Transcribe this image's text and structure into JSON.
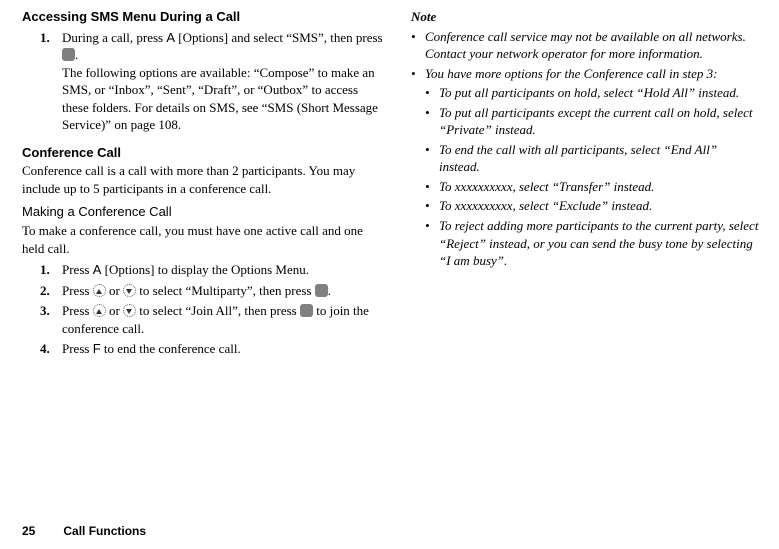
{
  "left": {
    "h1": "Accessing SMS Menu During a Call",
    "step1_num": "1.",
    "step1_a": "During a call, press ",
    "step1_key": "A",
    "step1_b": " [Options] and select “SMS”, then press ",
    "step1_c": ".",
    "step1_p2": "The following options are available: “Compose” to make an SMS, or “Inbox”, “Sent”, “Draft”, or “Outbox” to access these folders. For details on SMS, see “SMS (Short Message Service)” on page 108.",
    "h2": "Conference Call",
    "conf_intro": "Conference call is a call with more than 2 participants. You may include up to 5 participants in a conference call.",
    "h3": "Making a Conference Call",
    "make_intro": "To make a conference call, you must have one active call and one held call.",
    "s1_num": "1.",
    "s1_a": "Press ",
    "s1_key": "A",
    "s1_b": "  [Options] to display the Options Menu.",
    "s2_num": "2.",
    "s2_a": "Press ",
    "s2_b": " or ",
    "s2_c": " to select “Multiparty”, then press ",
    "s2_d": ".",
    "s3_num": "3.",
    "s3_a": "Press ",
    "s3_b": " or ",
    "s3_c": " to select “Join All”, then press ",
    "s3_d": " to join the conference call.",
    "s4_num": "4.",
    "s4_a": "Press ",
    "s4_key": "F",
    "s4_b": "   to end the conference call."
  },
  "right": {
    "note": "Note",
    "b1": "Conference call service may not be available on all networks. Contact your network operator for more information.",
    "b2": "You have more options for the Conference call in step 3:",
    "sb1": "To put all participants on hold, select “Hold All” instead.",
    "sb2": "To put all participants except the current call on hold, select “Private” instead.",
    "sb3": "To end the call with all participants, select “End All” instead.",
    "sb4": "To xxxxxxxxxx, select “Transfer” instead.",
    "sb5": "To xxxxxxxxxx, select “Exclude” instead.",
    "sb6": "To reject adding more participants to the current party, select “Reject” instead, or you can send the busy tone by selecting “I am busy”."
  },
  "footer": {
    "page": "25",
    "section": "Call Functions"
  }
}
